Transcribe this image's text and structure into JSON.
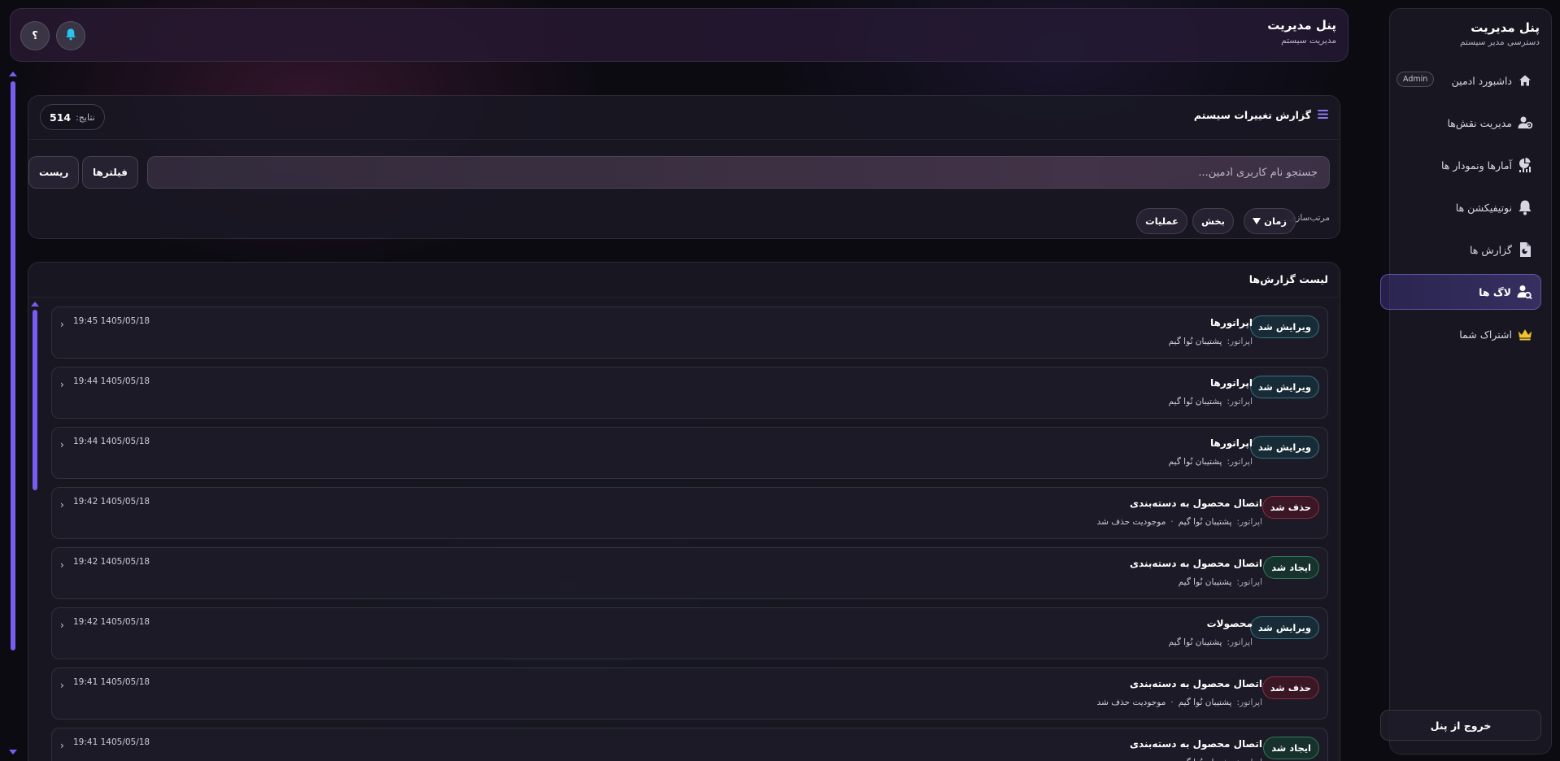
{
  "sidebar": {
    "title": "پنل مدیریت",
    "subtitle": "دسترسی مدیر سیستم",
    "items": [
      {
        "label": "داشبورد ادمین",
        "icon": "home-icon",
        "badge": "Admin"
      },
      {
        "label": "مدیریت نقش‌ها",
        "icon": "users-gear-icon"
      },
      {
        "label": "آمارها ونمودار ها",
        "icon": "chart-icon"
      },
      {
        "label": "نوتیفیکشن ها",
        "icon": "bell-icon"
      },
      {
        "label": "گزارش ها",
        "icon": "report-file-icon"
      },
      {
        "label": "لاگ ها",
        "icon": "user-search-icon",
        "active": true
      },
      {
        "label": "اشتراک شما",
        "icon": "crown-icon"
      }
    ],
    "logout": "خروج از پنل"
  },
  "header": {
    "title": "پنل مدیریت",
    "subtitle": "مدیریت سیستم",
    "help_label": "؟",
    "bell_icon": "bell-icon"
  },
  "filters": {
    "title": "گزارش تغییرات سیستم",
    "results_label": "نتایج:",
    "results_count": "514",
    "search_placeholder": "جستجو نام کاربری ادمین...",
    "filters_button": "فیلترها",
    "reset_button": "ریست",
    "sort_label": "مرتب‌سازی:",
    "sort_time": "زمان",
    "sort_section": "بخش",
    "sort_operation": "عملیات"
  },
  "list": {
    "title": "لیست گزارش‌ها",
    "operator_label": "اپراتور:",
    "rows": [
      {
        "badge": "ویرایش شد",
        "type": "edit",
        "title": "اپراتورها",
        "operator": "پشتیبان نُوا گیم",
        "extra": "",
        "time": "19:45 1405/05/18"
      },
      {
        "badge": "ویرایش شد",
        "type": "edit",
        "title": "اپراتورها",
        "operator": "پشتیبان نُوا گیم",
        "extra": "",
        "time": "19:44 1405/05/18"
      },
      {
        "badge": "ویرایش شد",
        "type": "edit",
        "title": "اپراتورها",
        "operator": "پشتیبان نُوا گیم",
        "extra": "",
        "time": "19:44 1405/05/18"
      },
      {
        "badge": "حذف شد",
        "type": "del",
        "title": "اتصال محصول به دسته‌بندی",
        "operator": "پشتیبان نُوا گیم",
        "extra": "موجودیت حذف شد",
        "time": "19:42 1405/05/18"
      },
      {
        "badge": "ایجاد شد",
        "type": "add",
        "title": "اتصال محصول به دسته‌بندی",
        "operator": "پشتیبان نُوا گیم",
        "extra": "",
        "time": "19:42 1405/05/18"
      },
      {
        "badge": "ویرایش شد",
        "type": "edit",
        "title": "محصولات",
        "operator": "پشتیبان نُوا گیم",
        "extra": "",
        "time": "19:42 1405/05/18"
      },
      {
        "badge": "حذف شد",
        "type": "del",
        "title": "اتصال محصول به دسته‌بندی",
        "operator": "پشتیبان نُوا گیم",
        "extra": "موجودیت حذف شد",
        "time": "19:41 1405/05/18"
      },
      {
        "badge": "ایجاد شد",
        "type": "add",
        "title": "اتصال محصول به دسته‌بندی",
        "operator": "پشتیبان نُوا گیم",
        "extra": "",
        "time": "19:41 1405/05/18"
      }
    ]
  },
  "colors": {
    "accent": "#7a5cf0",
    "edit": "#50aabe",
    "delete": "#c84664",
    "create": "#46b478",
    "crown": "#f2c230"
  }
}
